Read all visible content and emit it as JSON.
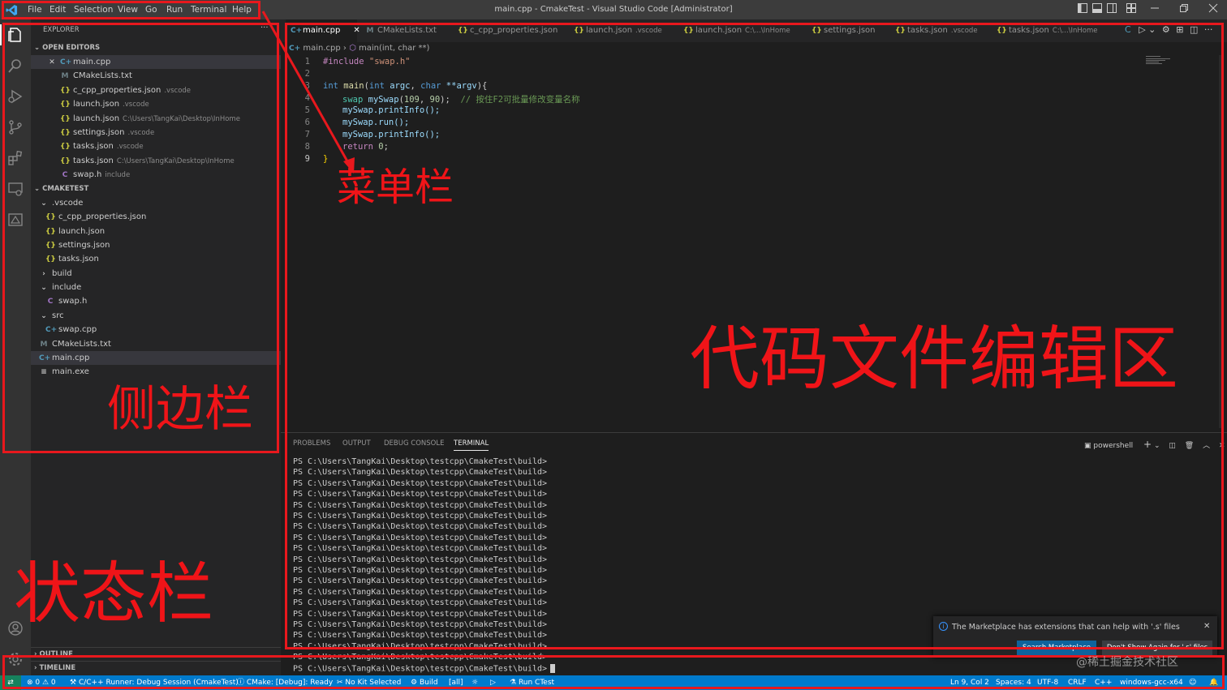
{
  "window": {
    "title": "main.cpp - CmakeTest - Visual Studio Code [Administrator]"
  },
  "menu": [
    "File",
    "Edit",
    "Selection",
    "View",
    "Go",
    "Run",
    "Terminal",
    "Help"
  ],
  "explorer": {
    "title": "EXPLORER",
    "more": "···",
    "open_editors_label": "OPEN EDITORS",
    "open_editors": [
      {
        "icon": "C+",
        "name": "main.cpp",
        "dim": "",
        "close": "✕",
        "color": "#519aba"
      },
      {
        "icon": "M",
        "name": "CMakeLists.txt",
        "dim": "",
        "color": "#6d8086"
      },
      {
        "icon": "{}",
        "name": "c_cpp_properties.json",
        "dim": ".vscode",
        "color": "#cbcb41"
      },
      {
        "icon": "{}",
        "name": "launch.json",
        "dim": ".vscode",
        "color": "#cbcb41"
      },
      {
        "icon": "{}",
        "name": "launch.json",
        "dim": "C:\\Users\\TangKai\\Desktop\\InHome",
        "color": "#cbcb41"
      },
      {
        "icon": "{}",
        "name": "settings.json",
        "dim": ".vscode",
        "color": "#cbcb41"
      },
      {
        "icon": "{}",
        "name": "tasks.json",
        "dim": ".vscode",
        "color": "#cbcb41"
      },
      {
        "icon": "{}",
        "name": "tasks.json",
        "dim": "C:\\Users\\TangKai\\Desktop\\InHome",
        "color": "#cbcb41"
      },
      {
        "icon": "C",
        "name": "swap.h",
        "dim": "include",
        "color": "#a074c4"
      }
    ],
    "project_label": "CMAKETEST",
    "tree": [
      {
        "icon": "⌄",
        "name": ".vscode",
        "level": 1,
        "color": "#ccc"
      },
      {
        "icon": "{}",
        "name": "c_cpp_properties.json",
        "level": 2,
        "color": "#cbcb41"
      },
      {
        "icon": "{}",
        "name": "launch.json",
        "level": 2,
        "color": "#cbcb41"
      },
      {
        "icon": "{}",
        "name": "settings.json",
        "level": 2,
        "color": "#cbcb41"
      },
      {
        "icon": "{}",
        "name": "tasks.json",
        "level": 2,
        "color": "#cbcb41"
      },
      {
        "icon": "›",
        "name": "build",
        "level": 1,
        "color": "#ccc"
      },
      {
        "icon": "⌄",
        "name": "include",
        "level": 1,
        "color": "#ccc"
      },
      {
        "icon": "C",
        "name": "swap.h",
        "level": 2,
        "color": "#a074c4"
      },
      {
        "icon": "⌄",
        "name": "src",
        "level": 1,
        "color": "#ccc"
      },
      {
        "icon": "C+",
        "name": "swap.cpp",
        "level": 2,
        "color": "#519aba"
      },
      {
        "icon": "M",
        "name": "CMakeLists.txt",
        "level": 1,
        "color": "#6d8086"
      },
      {
        "icon": "C+",
        "name": "main.cpp",
        "level": 1,
        "color": "#519aba",
        "selected": true
      },
      {
        "icon": "≡",
        "name": "main.exe",
        "level": 1,
        "color": "#ccc"
      }
    ],
    "outline_label": "OUTLINE",
    "timeline_label": "TIMELINE"
  },
  "tabs": [
    {
      "icon": "C+",
      "label": "main.cpp",
      "dim": "",
      "active": true,
      "close": "✕",
      "color": "#519aba"
    },
    {
      "icon": "M",
      "label": "CMakeLists.txt",
      "dim": "",
      "color": "#6d8086"
    },
    {
      "icon": "{}",
      "label": "c_cpp_properties.json",
      "dim": "",
      "color": "#cbcb41"
    },
    {
      "icon": "{}",
      "label": "launch.json",
      "dim": ".vscode",
      "color": "#cbcb41"
    },
    {
      "icon": "{}",
      "label": "launch.json",
      "dim": "C:\\...\\InHome",
      "color": "#cbcb41"
    },
    {
      "icon": "{}",
      "label": "settings.json",
      "dim": "",
      "color": "#cbcb41"
    },
    {
      "icon": "{}",
      "label": "tasks.json",
      "dim": ".vscode",
      "color": "#cbcb41"
    },
    {
      "icon": "{}",
      "label": "tasks.json",
      "dim": "C:\\...\\InHome",
      "color": "#cbcb41"
    }
  ],
  "breadcrumb": {
    "file": "main.cpp",
    "symbol": "main(int, char **)"
  },
  "code": {
    "line_numbers": [
      "1",
      "2",
      "3",
      "4",
      "5",
      "6",
      "7",
      "8",
      "9"
    ],
    "l1_pp": "#include",
    "l1_str": "\"swap.h\"",
    "l3_kw1": "int",
    "l3_fn": "main",
    "l3_kw2": "int",
    "l3_v1": "argc",
    "l3_kw3": "char",
    "l3_v2": "**argv",
    "l4_ty": "swap",
    "l4_v": "mySwap",
    "l4_n1": "109",
    "l4_n2": "90",
    "l4_cm": "// 按住F2可批量修改变量名称",
    "l5": "mySwap.printInfo();",
    "l6": "mySwap.run();",
    "l7": "mySwap.printInfo();",
    "l8_kw": "return",
    "l8_n": "0",
    "l9": "}"
  },
  "panel": {
    "tabs": [
      "PROBLEMS",
      "OUTPUT",
      "DEBUG CONSOLE",
      "TERMINAL"
    ],
    "shell": "powershell",
    "prompt": "PS C:\\Users\\TangKai\\Desktop\\testcpp\\CmakeTest\\build>",
    "prompt_count": "20"
  },
  "notification": {
    "message": "The Marketplace has extensions that can help with '.s' files",
    "btn1": "Search Marketplace",
    "btn2": "Don't Show Again for '.s' files",
    "close": "✕"
  },
  "statusbar": {
    "errors": "⊗ 0 ⚠ 0",
    "runner": "C/C++ Runner: Debug Session (CmakeTest)",
    "cmake": "CMake: [Debug]: Ready",
    "kit": "No Kit Selected",
    "build": "Build",
    "all": "[all]",
    "ctest": "Run CTest",
    "position": "Ln 9, Col 2",
    "spaces": "Spaces: 4",
    "encoding": "UTF-8",
    "eol": "CRLF",
    "lang": "C++",
    "platform": "windows-gcc-x64"
  },
  "annotations": {
    "menu_bar": "菜单栏",
    "editor_area": "代码文件编辑区",
    "sidebar": "侧边栏",
    "status_bar": "状态栏"
  },
  "watermark": "@稀土掘金技术社区"
}
